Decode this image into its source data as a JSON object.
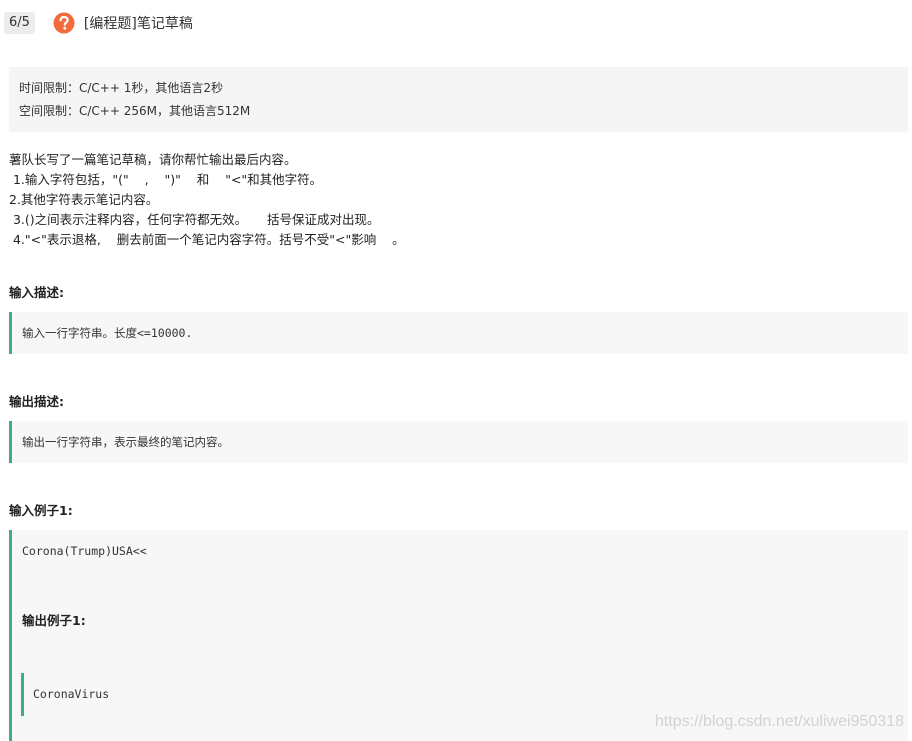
{
  "header": {
    "counter": "6/5",
    "icon": "question-circle-icon",
    "title": "[编程题]笔记草稿"
  },
  "limits": {
    "time": "时间限制：C/C++ 1秒，其他语言2秒",
    "space": "空间限制：C/C++ 256M，其他语言512M"
  },
  "description": [
    "薯队长写了一篇笔记草稿，请你帮忙输出最后内容。",
    " 1.输入字符包括，\"(\"    ,    \")\"    和    \"<\"和其他字符。",
    "2.其他字符表示笔记内容。",
    " 3.()之间表示注释内容，任何字符都无效。     括号保证成对出现。",
    " 4.\"<\"表示退格,    删去前面一个笔记内容字符。括号不受\"<\"影响    。"
  ],
  "input_desc": {
    "title": "输入描述:",
    "text": "输入一行字符串。长度<=10000."
  },
  "output_desc": {
    "title": "输出描述:",
    "text": "输出一行字符串，表示最终的笔记内容。"
  },
  "example": {
    "input_title": "输入例子1:",
    "input": "Corona(Trump)USA<<",
    "output_title": "输出例子1:",
    "output": "CoronaVirus"
  },
  "watermark": "https://blog.csdn.net/xuliwei950318",
  "colors": {
    "accent_orange": "#f26b3a",
    "border_green": "#3dab8f",
    "block_bg": "#f7f7f7"
  }
}
